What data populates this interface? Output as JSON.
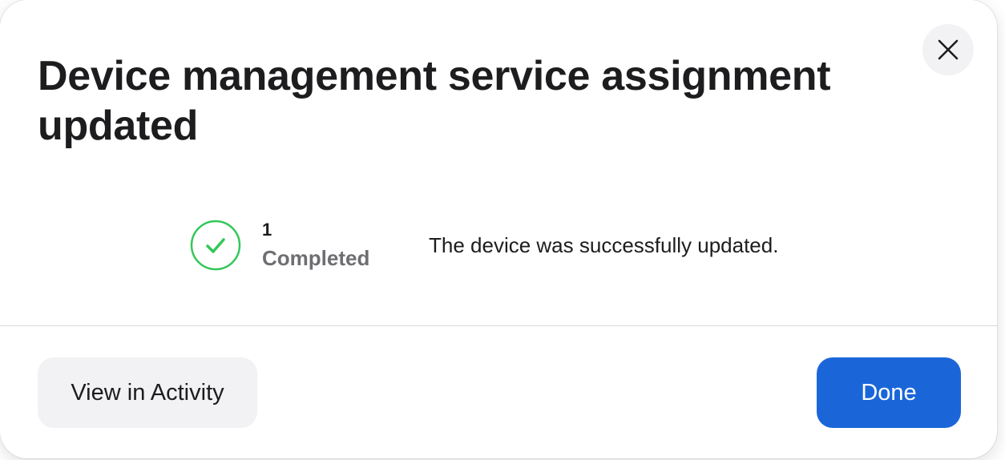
{
  "dialog": {
    "title": "Device management service assignment updated",
    "close_icon": "close-icon",
    "status": {
      "icon": "checkmark-circle-icon",
      "count": "1",
      "count_label": "Completed",
      "message": "The device was successfully updated.",
      "color": "#34c759"
    },
    "buttons": {
      "view_activity_label": "View in Activity",
      "done_label": "Done"
    },
    "colors": {
      "primary": "#1a66d9",
      "secondary_bg": "#f2f2f4"
    }
  }
}
